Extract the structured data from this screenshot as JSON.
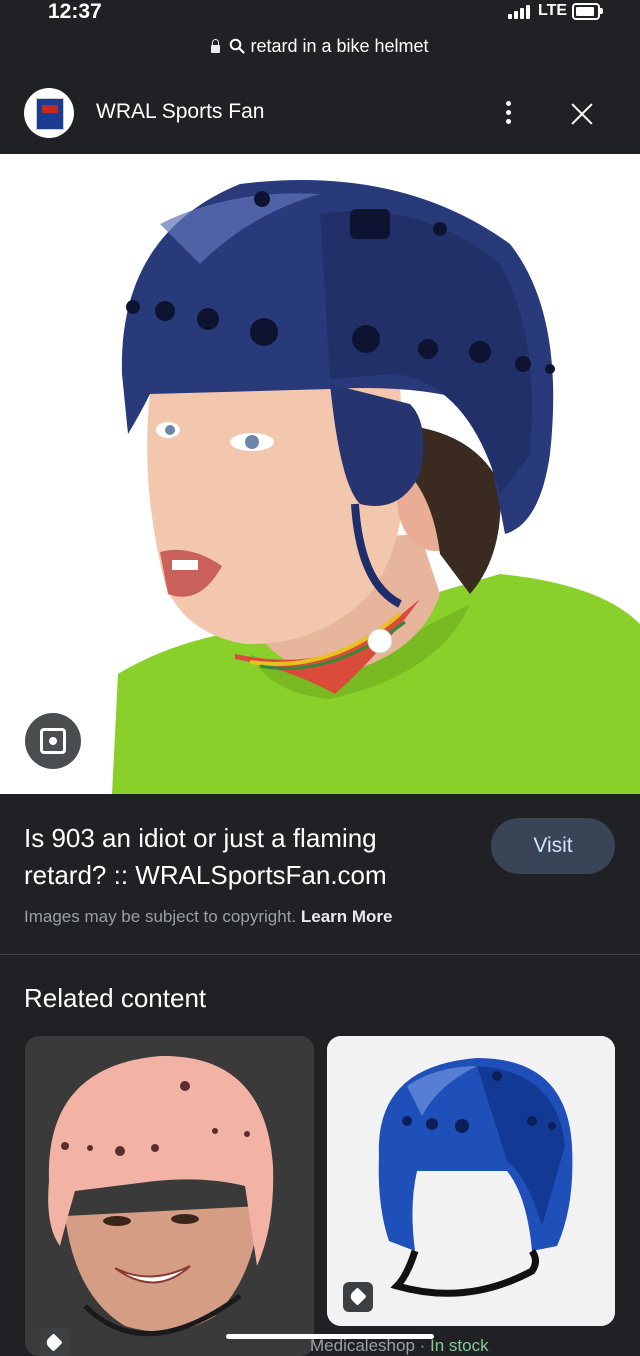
{
  "status_bar": {
    "time": "12:37",
    "network": "LTE"
  },
  "browser": {
    "url_text": "retard in a bike helmet"
  },
  "site": {
    "name": "WRAL Sports Fan"
  },
  "result": {
    "title": "Is 903 an idiot or just a flaming retard? :: WRALSportsFan.com",
    "visit_label": "Visit",
    "copyright_text": "Images may be subject to copyright.",
    "learn_more_label": "Learn More"
  },
  "related": {
    "heading": "Related content",
    "cards": [
      {
        "image": "child in pink protective helmet"
      },
      {
        "image": "blue protective helmet",
        "source": "Medicaleshop",
        "availability": "In stock"
      }
    ]
  },
  "colors": {
    "background": "#202124",
    "visit_button": "#394457",
    "in_stock": "#81c995"
  }
}
